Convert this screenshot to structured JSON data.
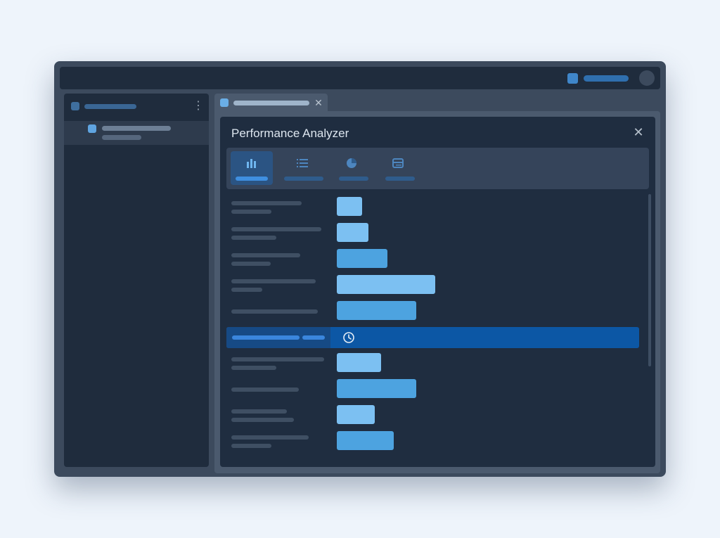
{
  "window": {
    "titlebar": {
      "account_icon": "square-icon",
      "avatar_icon": "avatar-icon"
    }
  },
  "sidebar": {
    "header": {
      "menu_icon": "kebab-menu-icon"
    },
    "items": [
      {
        "icon": "file-icon"
      }
    ]
  },
  "tabs": [
    {
      "icon": "file-icon",
      "close_glyph": "✕"
    }
  ],
  "dialog": {
    "title": "Performance Analyzer",
    "close_glyph": "✕",
    "toolbar": [
      {
        "icon": "bar-chart-icon",
        "active": true
      },
      {
        "icon": "list-icon",
        "active": false
      },
      {
        "icon": "pie-chart-icon",
        "active": false
      },
      {
        "icon": "table-icon",
        "active": false
      }
    ],
    "rows": [
      {
        "value": 0.08,
        "color": "#7cc0f2"
      },
      {
        "value": 0.1,
        "color": "#7cc0f2"
      },
      {
        "value": 0.16,
        "color": "#4da3e0"
      },
      {
        "value": 0.31,
        "color": "#7cc0f2"
      },
      {
        "value": 0.25,
        "color": "#4da3e0"
      },
      {
        "selected": true,
        "icon": "clock-icon",
        "color": "#0c57a5"
      },
      {
        "value": 0.14,
        "color": "#7cc0f2"
      },
      {
        "value": 0.25,
        "color": "#4da3e0"
      },
      {
        "value": 0.12,
        "color": "#7cc0f2"
      },
      {
        "value": 0.18,
        "color": "#4da3e0"
      }
    ]
  },
  "colors": {
    "background": "#eef4fb",
    "window": "#3c4a5d",
    "panel": "#1f2d40",
    "accent": "#0c57a5",
    "bar_light": "#7cc0f2",
    "bar_mid": "#4da3e0"
  }
}
